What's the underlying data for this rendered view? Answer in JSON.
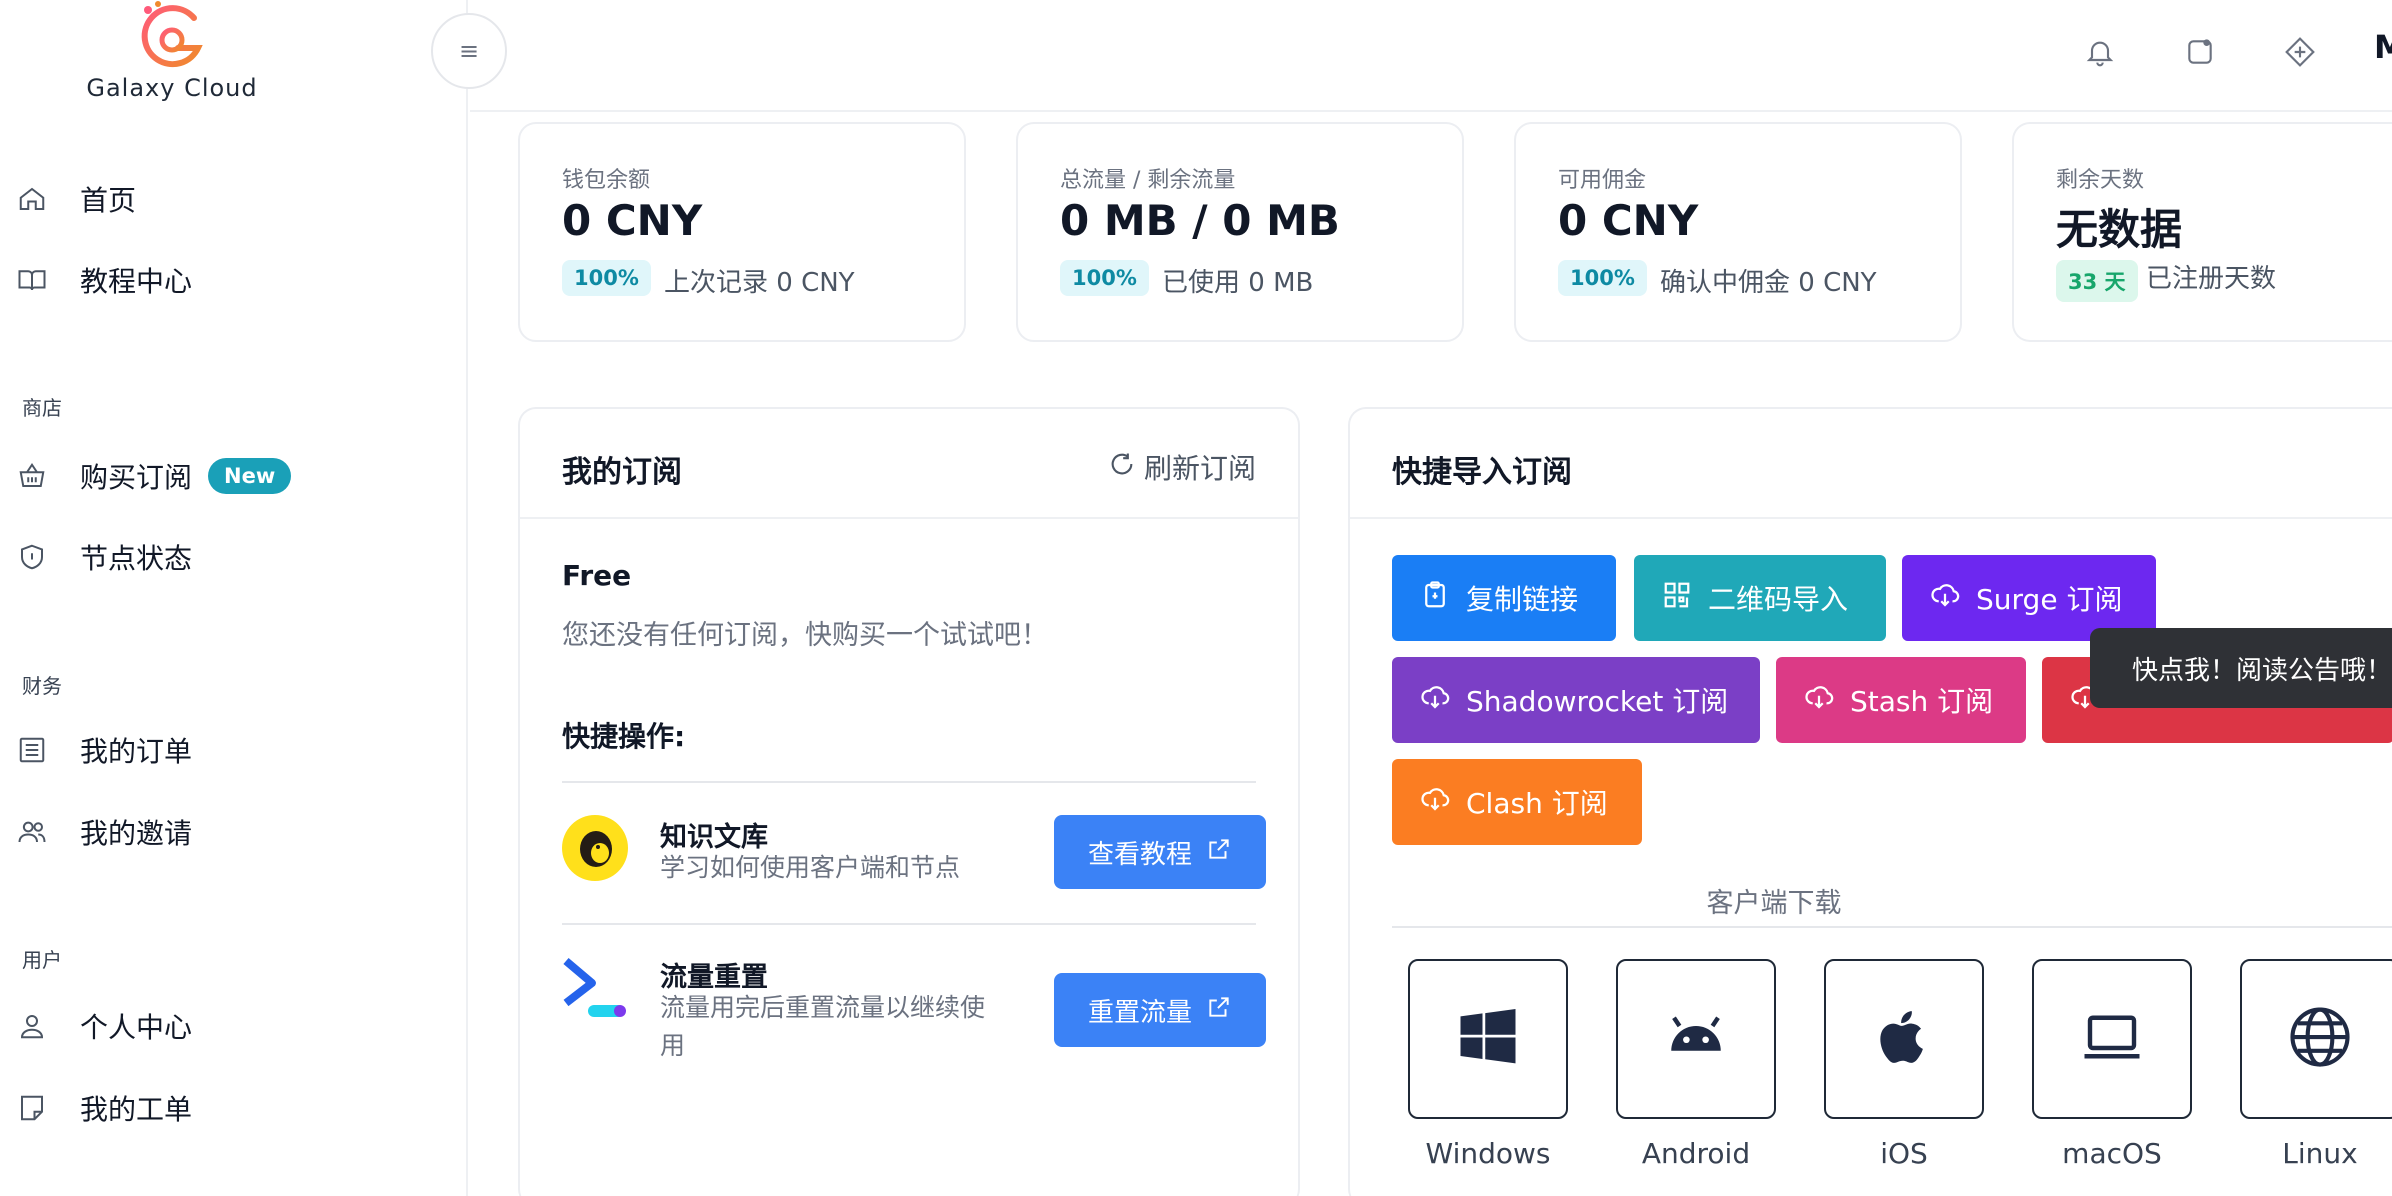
{
  "brand": {
    "name": "Galaxy Cloud"
  },
  "sidebar": {
    "items": [
      {
        "label": "首页",
        "icon": "home-icon"
      },
      {
        "label": "教程中心",
        "icon": "book-icon"
      },
      {
        "section": "商店"
      },
      {
        "label": "购买订阅",
        "icon": "basket-icon",
        "badge": "New"
      },
      {
        "label": "节点状态",
        "icon": "shield-icon"
      },
      {
        "section": "财务"
      },
      {
        "label": "我的订单",
        "icon": "receipt-icon"
      },
      {
        "label": "我的邀请",
        "icon": "users-icon"
      },
      {
        "section": "用户"
      },
      {
        "label": "个人中心",
        "icon": "user-icon"
      },
      {
        "label": "我的工单",
        "icon": "ticket-icon"
      }
    ]
  },
  "header": {
    "menu_icon": "≡",
    "icons": [
      "bell-icon",
      "theme-icon",
      "language-icon"
    ],
    "cut_text": "M"
  },
  "stats": [
    {
      "title": "钱包余额",
      "value": "0 CNY",
      "pill": "100%",
      "note": "上次记录 0 CNY"
    },
    {
      "title": "总流量 / 剩余流量",
      "value": "0 MB / 0 MB",
      "pill": "100%",
      "note": "已使用 0 MB"
    },
    {
      "title": "可用佣金",
      "value": "0 CNY",
      "pill": "100%",
      "note": "确认中佣金 0 CNY"
    },
    {
      "title": "剩余天数",
      "value": "无数据",
      "pill": "33 天",
      "note": "已注册天数"
    }
  ],
  "subscription": {
    "title": "我的订阅",
    "refresh": "刷新订阅",
    "plan": "Free",
    "desc": "您还没有任何订阅，快购买一个试试吧！",
    "quick_label": "快捷操作:",
    "actions": [
      {
        "title": "知识文库",
        "sub": "学习如何使用客户端和节点",
        "button": "查看教程"
      },
      {
        "title": "流量重置",
        "sub": "流量用完后重置流量以继续使用",
        "button": "重置流量"
      }
    ]
  },
  "quick_import": {
    "title": "快捷导入订阅",
    "buttons": [
      {
        "label": "复制链接",
        "color": "#1a7ef5",
        "icon": "clipboard-icon"
      },
      {
        "label": "二维码导入",
        "color": "#20a8b8",
        "icon": "qrcode-icon"
      },
      {
        "label": "Surge 订阅",
        "color": "#6d28f0",
        "icon": "cloud-download-icon"
      },
      {
        "label": "Shadowrocket 订阅",
        "color": "#7b3fc6",
        "icon": "cloud-download-icon"
      },
      {
        "label": "Stash 订阅",
        "color": "#dc3a86",
        "icon": "cloud-download-icon"
      },
      {
        "label": "",
        "color": "#dc3545",
        "icon": "cloud-download-icon"
      },
      {
        "label": "Clash 订阅",
        "color": "#fb7d22",
        "icon": "cloud-download-icon"
      }
    ],
    "client_caption": "客户端下载",
    "clients": [
      {
        "name": "Windows",
        "icon": "windows-icon"
      },
      {
        "name": "Android",
        "icon": "android-icon"
      },
      {
        "name": "iOS",
        "icon": "apple-icon"
      },
      {
        "name": "macOS",
        "icon": "laptop-icon"
      },
      {
        "name": "Linux",
        "icon": "globe-icon"
      }
    ]
  },
  "tooltip": {
    "text": "快点我！阅读公告哦！"
  }
}
